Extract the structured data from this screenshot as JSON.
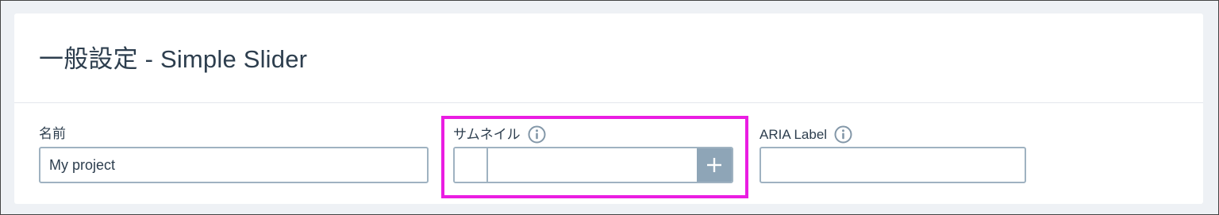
{
  "page": {
    "title": "一般設定 - Simple Slider"
  },
  "fields": {
    "name": {
      "label": "名前",
      "value": "My project"
    },
    "thumbnail": {
      "label": "サムネイル",
      "info_icon": "info-circle-icon",
      "add_icon": "plus-icon",
      "value": ""
    },
    "aria_label": {
      "label": "ARIA Label",
      "info_icon": "info-circle-icon",
      "value": ""
    }
  },
  "colors": {
    "background": "#eef1f5",
    "card": "#ffffff",
    "text": "#2d3e4e",
    "input_border": "#9fb2c1",
    "add_button": "#8ea5b7",
    "highlight": "#ea1de2"
  }
}
